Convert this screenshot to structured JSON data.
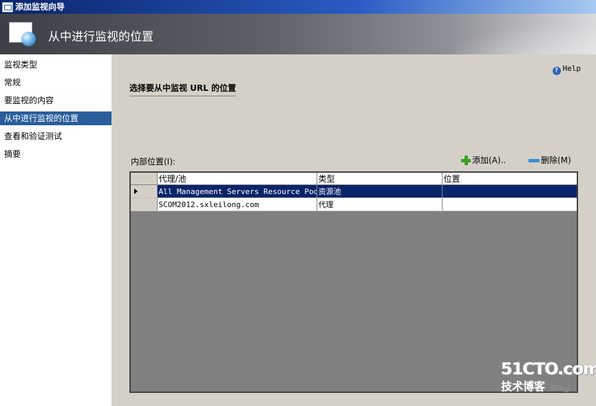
{
  "window": {
    "title": "添加监视向导"
  },
  "banner": {
    "title": "从中进行监视的位置"
  },
  "nav": {
    "items": [
      {
        "label": "监视类型"
      },
      {
        "label": "常规"
      },
      {
        "label": "要监视的内容"
      },
      {
        "label": "从中进行监视的位置",
        "selected": true
      },
      {
        "label": "查看和验证测试"
      },
      {
        "label": "摘要"
      }
    ]
  },
  "help": {
    "label": "Help"
  },
  "section": {
    "title": "选择要从中监视 URL 的位置"
  },
  "internal": {
    "label": "内部位置(I):",
    "add_label": "添加(A)..",
    "delete_label": "删除(M)",
    "columns": [
      "代理/池",
      "类型",
      "位置"
    ],
    "rows": [
      {
        "agent": "All Management Servers Resource Pool",
        "type": "资源池",
        "location": "",
        "selected": true
      },
      {
        "agent": "SCOM2012.sxleilong.com",
        "type": "代理",
        "location": "",
        "selected": false
      }
    ]
  },
  "watermark": {
    "logo": "51CTO.com",
    "sub": "技术博客",
    "blog": "Blog"
  }
}
